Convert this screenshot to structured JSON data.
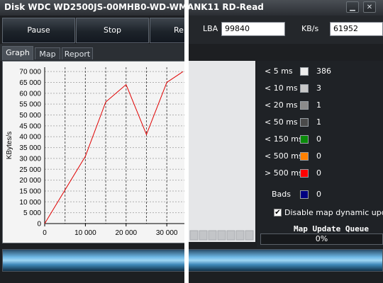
{
  "window": {
    "title": "Disk WDC WD2500JS-00MHB0-WD-WMANK11 RD-Read",
    "min_glyph": "▁",
    "close_glyph": "✕"
  },
  "toolbar": {
    "pause_label": "Pause",
    "stop_label": "Stop",
    "partial_label": "Re"
  },
  "stats": {
    "lba_label": "LBA",
    "lba_value": "99840",
    "speed_label": "KB/s",
    "speed_value": "61952"
  },
  "tabs": [
    {
      "label": "Graph",
      "active": true
    },
    {
      "label": "Map",
      "active": false
    },
    {
      "label": "Report",
      "active": false
    }
  ],
  "legend": {
    "items": [
      {
        "label": "< 5 ms",
        "count": "386",
        "color": "#ededed"
      },
      {
        "label": "< 10 ms",
        "count": "3",
        "color": "#c8c8c8"
      },
      {
        "label": "< 20 ms",
        "count": "1",
        "color": "#8a8a8a"
      },
      {
        "label": "< 50 ms",
        "count": "1",
        "color": "#4a4a4a"
      },
      {
        "label": "< 150 ms",
        "count": "0",
        "color": "#0a8a0a"
      },
      {
        "label": "< 500 ms",
        "count": "0",
        "color": "#ff8000"
      },
      {
        "label": "> 500 ms",
        "count": "0",
        "color": "#ff0000"
      }
    ],
    "bads": {
      "label": "Bads",
      "count": "0",
      "color": "#000080"
    },
    "disable_map_label": "Disable map dynamic update",
    "disable_map_checked": "✔",
    "queue_title": "Map Update Queue",
    "queue_value": "0%"
  },
  "chart_data": {
    "type": "line",
    "xlabel": "",
    "ylabel": "KBytes/s",
    "x": [
      0,
      10000,
      15000,
      20000,
      25000,
      30000,
      34000
    ],
    "series": [
      {
        "values": [
          0,
          31000,
          56000,
          64000,
          41000,
          65000,
          70000
        ]
      }
    ],
    "xlim": [
      0,
      34500
    ],
    "ylim": [
      0,
      72000
    ],
    "yticks": [
      0,
      5000,
      10000,
      15000,
      20000,
      25000,
      30000,
      35000,
      40000,
      45000,
      50000,
      55000,
      60000,
      65000,
      70000
    ],
    "ytick_labels": [
      "0",
      "5 000",
      "10 000",
      "15 000",
      "20 000",
      "25 000",
      "30 000",
      "35 000",
      "40 000",
      "45 000",
      "50 000",
      "55 000",
      "60 000",
      "65 000",
      "70 000"
    ],
    "xticks": [
      0,
      10000,
      20000,
      30000
    ],
    "xtick_labels": [
      "0",
      "10 000",
      "20 000",
      "30 000"
    ],
    "grid": true,
    "line_color": "#e00000"
  }
}
